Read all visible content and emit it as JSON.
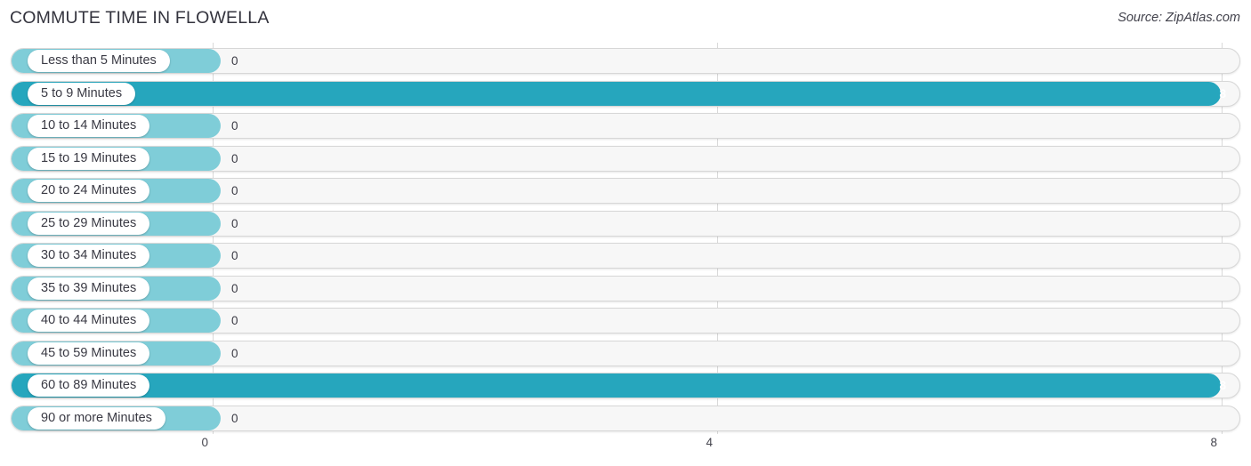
{
  "header": {
    "title": "COMMUTE TIME IN FLOWELLA",
    "source": "Source: ZipAtlas.com"
  },
  "colors": {
    "bar_full": "#26a6bd",
    "bar_zero": "#7fcdd8",
    "track_bg": "#f7f7f7",
    "track_border": "#d7d7d7",
    "gridline": "#d9d9d9",
    "text": "#3a3a44"
  },
  "chart_data": {
    "type": "bar",
    "orientation": "horizontal",
    "title": "COMMUTE TIME IN FLOWELLA",
    "xlabel": "",
    "ylabel": "",
    "xlim": [
      0,
      8
    ],
    "grid": true,
    "legend": "none",
    "xticks": [
      "0",
      "4",
      "8"
    ],
    "xtick_values": [
      0,
      4,
      8
    ],
    "categories": [
      "Less than 5 Minutes",
      "5 to 9 Minutes",
      "10 to 14 Minutes",
      "15 to 19 Minutes",
      "20 to 24 Minutes",
      "25 to 29 Minutes",
      "30 to 34 Minutes",
      "35 to 39 Minutes",
      "40 to 44 Minutes",
      "45 to 59 Minutes",
      "60 to 89 Minutes",
      "90 or more Minutes"
    ],
    "values": [
      0,
      8,
      0,
      0,
      0,
      0,
      0,
      0,
      0,
      0,
      8,
      0
    ],
    "value_labels": [
      "0",
      "8",
      "0",
      "0",
      "0",
      "0",
      "0",
      "0",
      "0",
      "0",
      "8",
      "0"
    ]
  }
}
